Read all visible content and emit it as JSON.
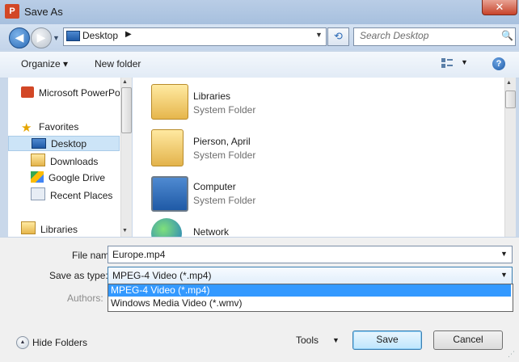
{
  "window": {
    "title": "Save As",
    "app_icon_letter": "P",
    "close_glyph": "✕"
  },
  "nav": {
    "back_glyph": "◀",
    "forward_glyph": "▶",
    "recent_glyph": "▼",
    "address": "Desktop",
    "address_sep": "▶",
    "address_drop": "▼",
    "refresh_glyph": "⟲",
    "search_placeholder": "Search Desktop",
    "search_glyph": "🔍"
  },
  "toolbar": {
    "organize": "Organize ▾",
    "new_folder": "New folder",
    "views_drop": "▼",
    "help": "?"
  },
  "sidebar": {
    "app": "Microsoft PowerPoint",
    "favorites": "Favorites",
    "items": [
      "Desktop",
      "Downloads",
      "Google Drive",
      "Recent Places"
    ],
    "libraries": "Libraries"
  },
  "files": [
    {
      "name": "Libraries",
      "type": "System Folder"
    },
    {
      "name": "Pierson, April",
      "type": "System Folder"
    },
    {
      "name": "Computer",
      "type": "System Folder"
    },
    {
      "name": "Network",
      "type": ""
    }
  ],
  "form": {
    "file_name_label": "File name:",
    "file_name_value": "Europe.mp4",
    "save_type_label": "Save as type:",
    "save_type_value": "MPEG-4 Video (*.mp4)",
    "authors_label": "Authors:",
    "type_options": [
      "MPEG-4 Video (*.mp4)",
      "Windows Media Video (*.wmv)"
    ],
    "drop_glyph": "▼"
  },
  "footer": {
    "hide_folders": "Hide Folders",
    "hide_glyph": "▲",
    "tools": "Tools",
    "tools_drop": "▼",
    "save": "Save",
    "cancel": "Cancel"
  },
  "scroll": {
    "up": "▲",
    "down": "▼"
  }
}
